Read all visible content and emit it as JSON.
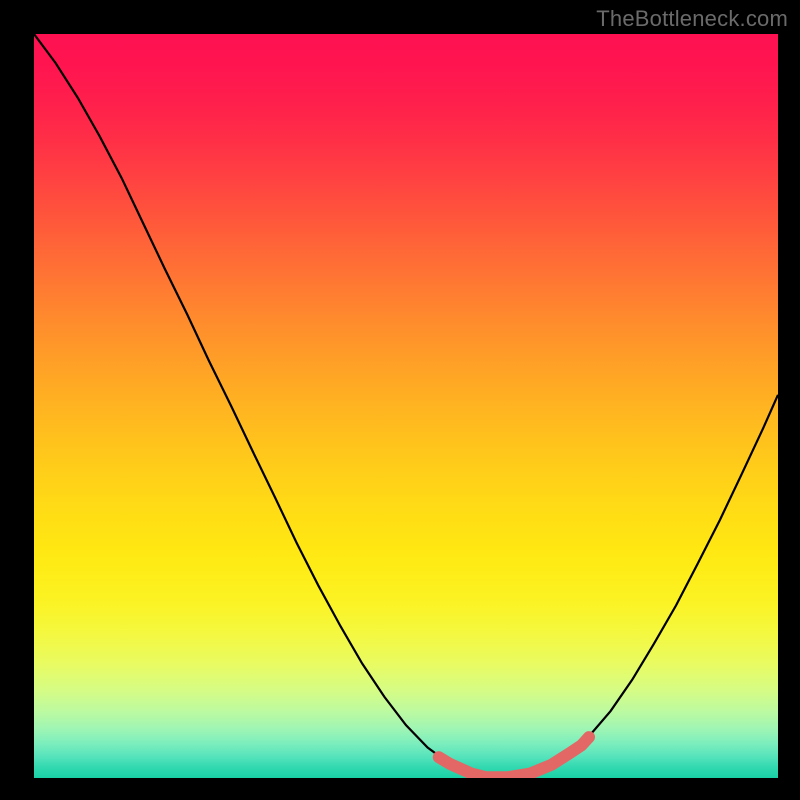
{
  "watermark": {
    "text": "TheBottleneck.com"
  },
  "gradient": {
    "stops": [
      {
        "offset": 0.0,
        "color": "#ff1151"
      },
      {
        "offset": 0.04,
        "color": "#ff1450"
      },
      {
        "offset": 0.09,
        "color": "#ff1f4c"
      },
      {
        "offset": 0.14,
        "color": "#ff2e47"
      },
      {
        "offset": 0.19,
        "color": "#ff4042"
      },
      {
        "offset": 0.24,
        "color": "#ff533c"
      },
      {
        "offset": 0.29,
        "color": "#ff6737"
      },
      {
        "offset": 0.34,
        "color": "#ff7a32"
      },
      {
        "offset": 0.39,
        "color": "#ff8d2c"
      },
      {
        "offset": 0.44,
        "color": "#ff9f27"
      },
      {
        "offset": 0.49,
        "color": "#ffb022"
      },
      {
        "offset": 0.54,
        "color": "#ffc01d"
      },
      {
        "offset": 0.59,
        "color": "#ffcf19"
      },
      {
        "offset": 0.64,
        "color": "#ffdc15"
      },
      {
        "offset": 0.69,
        "color": "#ffe712"
      },
      {
        "offset": 0.725,
        "color": "#feed18"
      },
      {
        "offset": 0.765,
        "color": "#fbf325"
      },
      {
        "offset": 0.805,
        "color": "#f4f83f"
      },
      {
        "offset": 0.845,
        "color": "#e9fb60"
      },
      {
        "offset": 0.88,
        "color": "#d7fc82"
      },
      {
        "offset": 0.91,
        "color": "#bdfaa0"
      },
      {
        "offset": 0.935,
        "color": "#9df5b4"
      },
      {
        "offset": 0.955,
        "color": "#79edbd"
      },
      {
        "offset": 0.972,
        "color": "#54e3bb"
      },
      {
        "offset": 0.985,
        "color": "#33d9b1"
      },
      {
        "offset": 1.0,
        "color": "#19d1a5"
      }
    ]
  },
  "chart_data": {
    "type": "line",
    "title": "",
    "xlabel": "",
    "ylabel": "",
    "xlim": [
      0,
      100
    ],
    "ylim": [
      0,
      100
    ],
    "series": [
      {
        "name": "bottleneck-curve",
        "color": "#000000",
        "width": 2.2,
        "x": [
          0.0,
          2.9,
          5.9,
          8.8,
          11.8,
          14.7,
          17.6,
          20.6,
          23.5,
          26.5,
          29.4,
          32.4,
          35.3,
          38.2,
          41.2,
          44.1,
          47.1,
          50.0,
          52.9,
          55.9,
          58.8,
          60.8,
          63.7,
          66.7,
          69.6,
          72.1,
          74.5,
          77.5,
          80.4,
          83.3,
          86.3,
          89.2,
          92.2,
          95.1,
          98.0,
          100.0
        ],
        "y": [
          100.0,
          96.1,
          91.4,
          86.3,
          80.6,
          74.5,
          68.4,
          62.3,
          56.1,
          50.0,
          43.9,
          37.7,
          31.6,
          25.9,
          20.4,
          15.4,
          10.9,
          7.1,
          4.1,
          1.9,
          0.6,
          0.1,
          0.1,
          0.6,
          1.8,
          3.4,
          5.5,
          9.0,
          13.2,
          18.0,
          23.2,
          28.8,
          34.7,
          40.8,
          47.0,
          51.5
        ]
      },
      {
        "name": "optimum-marker",
        "color": "#e36865",
        "width": 12,
        "linecap": "round",
        "x": [
          54.4,
          55.9,
          58.8,
          60.8,
          63.7,
          66.7,
          69.6,
          72.1,
          73.6,
          74.6
        ],
        "y": [
          2.8,
          1.9,
          0.6,
          0.1,
          0.1,
          0.6,
          1.8,
          3.4,
          4.4,
          5.5
        ]
      }
    ]
  }
}
